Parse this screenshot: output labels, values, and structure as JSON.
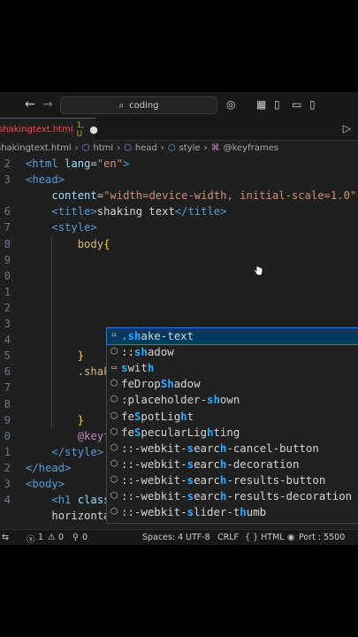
{
  "titlebar": {
    "back_icon": "arrow-left-icon",
    "forward_icon": "arrow-right-icon",
    "search_text": "coding",
    "search_icon": "search-icon"
  },
  "tab": {
    "filename": "shakingtext.html",
    "problems": "1, U",
    "modified": "●"
  },
  "breadcrumb": [
    "shakingtext.html",
    "html",
    "head",
    "style",
    "@keyframes"
  ],
  "editor": {
    "lines": [
      {
        "n": "2",
        "html": "<span class='tag'>&lt;html</span> <span class='attr'>lang</span>=<span class='str'>\"en\"</span><span class='tag'>&gt;</span>"
      },
      {
        "n": "3",
        "html": "<span class='tag'>&lt;head&gt;</span>"
      },
      {
        "n": "",
        "html": "    <span class='attr'>content</span>=<span class='str'>\"width=device-width, initial-scale=1.0\"</span>"
      },
      {
        "n": "6",
        "html": "    <span class='tag'>&lt;title&gt;</span><span class='txt'>shaking text</span><span class='tag'>&lt;/title&gt;</span>"
      },
      {
        "n": "7",
        "html": "    <span class='tag'>&lt;style&gt;</span>"
      },
      {
        "n": "8",
        "html": "        <span class='sel'>body</span><span class='brace'>{</span>"
      },
      {
        "n": "9",
        "html": ""
      },
      {
        "n": "0",
        "html": ""
      },
      {
        "n": "1",
        "html": ""
      },
      {
        "n": "2",
        "html": ""
      },
      {
        "n": "3",
        "html": ""
      },
      {
        "n": "4",
        "html": ""
      },
      {
        "n": "5",
        "html": "        <span class='brace'>}</span>"
      },
      {
        "n": "6",
        "html": "        <span class='sel'>.shak</span>"
      },
      {
        "n": "7",
        "html": ""
      },
      {
        "n": "8",
        "html": ""
      },
      {
        "n": "9",
        "html": "        <span class='brace'>}</span>"
      },
      {
        "n": "0",
        "html": "        <span class='kw'>@keyframes</span> <span class='plain'>sh</span>"
      },
      {
        "n": "1",
        "html": "    <span class='tag'>&lt;/style&gt;</span>"
      },
      {
        "n": "2",
        "html": "<span class='tag'>&lt;/head&gt;</span>"
      },
      {
        "n": "3",
        "html": "<span class='tag'>&lt;body&gt;</span>"
      },
      {
        "n": "4",
        "html": "    <span class='tag'>&lt;h1</span> <span class='attr'>class</span>=<span class='str'>\"shake-text\"</span><span class='tag'>&gt;</span><span class='txt'>text shaking</span>"
      },
      {
        "n": "",
        "html": "    <span class='txt'>horizontally</span><span class='tag'>&lt;/h1&gt;</span>"
      }
    ]
  },
  "suggestions": [
    {
      "icon": "snippet-icon",
      "html": "<span class='hl'>.sh</span>ake-text",
      "active": true
    },
    {
      "icon": "property-icon",
      "html": "::<span class='hl'>sh</span>adow"
    },
    {
      "icon": "keyword-icon",
      "html": "<span class='hl'>s</span>wit<span class='hl'>h</span>"
    },
    {
      "icon": "property-icon",
      "html": "feDrop<span class='hl'>Sh</span>adow"
    },
    {
      "icon": "property-icon",
      "html": ":placeholder-<span class='hl'>sh</span>own"
    },
    {
      "icon": "property-icon",
      "html": "fe<span class='hl'>S</span>potLig<span class='hl'>h</span>t"
    },
    {
      "icon": "property-icon",
      "html": "fe<span class='hl'>S</span>pecularLig<span class='hl'>h</span>ting"
    },
    {
      "icon": "property-icon",
      "html": "::-webkit-<span class='hl'>s</span>earc<span class='hl'>h</span>-cancel-button"
    },
    {
      "icon": "property-icon",
      "html": "::-webkit-<span class='hl'>s</span>earc<span class='hl'>h</span>-decoration"
    },
    {
      "icon": "property-icon",
      "html": "::-webkit-<span class='hl'>s</span>earc<span class='hl'>h</span>-results-button"
    },
    {
      "icon": "property-icon",
      "html": "::-webkit-<span class='hl'>s</span>earc<span class='hl'>h</span>-results-decoration"
    },
    {
      "icon": "property-icon",
      "html": "::-webkit-<span class='hl'>s</span>lider-t<span class='hl'>h</span>umb"
    }
  ],
  "statusbar": {
    "errors": "1",
    "warnings": "0",
    "broadcast": "0",
    "spaces": "Spaces: 4",
    "encoding": "UTF-8",
    "eol": "CRLF",
    "language": "{ } HTML",
    "port": "Port : 5500"
  }
}
